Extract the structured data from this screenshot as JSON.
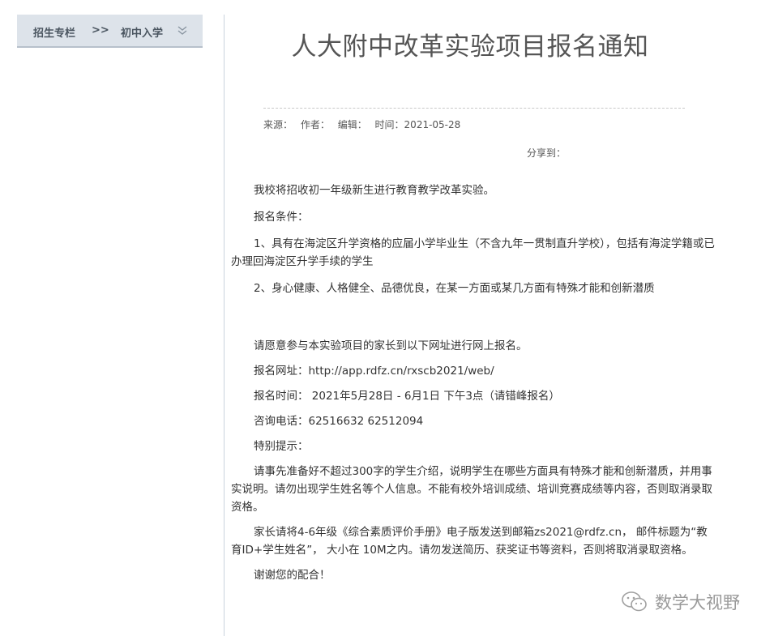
{
  "breadcrumb": {
    "item1": "招生专栏",
    "separator": ">>",
    "item2": "初中入学"
  },
  "article": {
    "title": "人大附中改革实验项目报名通知",
    "meta": {
      "source_label": "来源：",
      "author_label": "作者：",
      "editor_label": "编辑：",
      "time_label": "时间：",
      "time_value": "2021-05-28"
    },
    "share_label": "分享到：",
    "paragraphs": [
      "我校将招收初一年级新生进行教育教学改革实验。",
      "报名条件：",
      "1、具有在海淀区升学资格的应届小学毕业生（不含九年一贯制直升学校），包括有海淀学籍或已办理回海淀区升学手续的学生",
      "2、身心健康、人格健全、品德优良，在某一方面或某几方面有特殊才能和创新潜质",
      "请愿意参与本实验项目的家长到以下网址进行网上报名。",
      "报名网址：http://app.rdfz.cn/rxscb2021/web/",
      "报名时间： 2021年5月28日 - 6月1日 下午3点（请错峰报名）",
      "咨询电话：62516632   62512094",
      "特别提示：",
      " 请事先准备好不超过300字的学生介绍，说明学生在哪些方面具有特殊才能和创新潜质，并用事实说明。请勿出现学生姓名等个人信息。不能有校外培训成绩、培训竞赛成绩等内容，否则取消录取资格。",
      "家长请将4-6年级《综合素质评价手册》电子版发送到邮箱zs2021@rdfz.cn， 邮件标题为“教育ID+学生姓名”， 大小在 10M之内。请勿发送简历、获奖证书等资料，否则将取消录取资格。",
      "谢谢您的配合！"
    ]
  },
  "watermark": {
    "text": "数学大视野",
    "icon": "wechat-icon"
  }
}
